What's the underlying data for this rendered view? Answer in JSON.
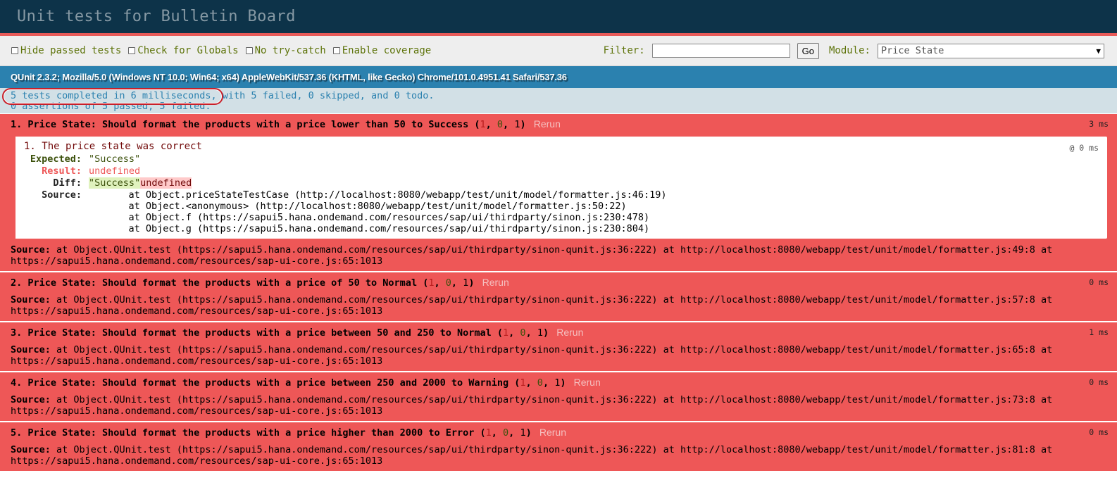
{
  "header": {
    "title": "Unit tests for Bulletin Board"
  },
  "toolbar": {
    "checkboxes": [
      "Hide passed tests",
      "Check for Globals",
      "No try-catch",
      "Enable coverage"
    ],
    "filter_label": "Filter:",
    "filter_value": "",
    "go_label": "Go",
    "module_label": "Module:",
    "module_selected": "Price State"
  },
  "useragent": "QUnit 2.3.2; Mozilla/5.0 (Windows NT 10.0; Win64; x64) AppleWebKit/537.36 (KHTML, like Gecko) Chrome/101.0.4951.41 Safari/537.36",
  "summary": {
    "line1_a": "5 tests completed in 6 milliseconds",
    "line1_b": ", with 5 failed, 0 skipped, and 0 todo.",
    "line2": "0 assertions of 5 passed, 5 failed."
  },
  "colors": {
    "header_bg": "#0d3349",
    "fail_bg": "#ee5757",
    "useragent_bg": "#2b81af",
    "summary_bg": "#d2e0e6",
    "highlight_oval": "#c8202a"
  },
  "tests": [
    {
      "name": "1. Price State: Should format the products with a price lower than 50 to Success",
      "failed": "1",
      "passed": "0",
      "total": "1",
      "rerun": "Rerun",
      "runtime": "3 ms",
      "source_label": "Source:",
      "source": " at Object.QUnit.test (https://sapui5.hana.ondemand.com/resources/sap/ui/thirdparty/sinon-qunit.js:36:222) at http://localhost:8080/webapp/test/unit/model/formatter.js:49:8 at https://sapui5.hana.ondemand.com/resources/sap-ui-core.js:65:1013",
      "assertion": {
        "title": "1. The price state was correct",
        "time": "@ 0 ms",
        "expected_label": "Expected:",
        "expected": "\"Success\"",
        "result_label": "Result:",
        "result": "undefined",
        "diff_label": "Diff:",
        "diff_ins": "\"Success\"",
        "diff_del": "undefined",
        "source_label": "Source:",
        "stack": "    at Object.priceStateTestCase (http://localhost:8080/webapp/test/unit/model/formatter.js:46:19)\n    at Object.<anonymous> (http://localhost:8080/webapp/test/unit/model/formatter.js:50:22)\n    at Object.f (https://sapui5.hana.ondemand.com/resources/sap/ui/thirdparty/sinon.js:230:478)\n    at Object.g (https://sapui5.hana.ondemand.com/resources/sap/ui/thirdparty/sinon.js:230:804)"
      }
    },
    {
      "name": "2. Price State: Should format the products with a price of 50 to Normal",
      "failed": "1",
      "passed": "0",
      "total": "1",
      "rerun": "Rerun",
      "runtime": "0 ms",
      "source_label": "Source:",
      "source": " at Object.QUnit.test (https://sapui5.hana.ondemand.com/resources/sap/ui/thirdparty/sinon-qunit.js:36:222) at http://localhost:8080/webapp/test/unit/model/formatter.js:57:8 at https://sapui5.hana.ondemand.com/resources/sap-ui-core.js:65:1013"
    },
    {
      "name": "3. Price State: Should format the products with a price between 50 and 250 to Normal",
      "failed": "1",
      "passed": "0",
      "total": "1",
      "rerun": "Rerun",
      "runtime": "1 ms",
      "source_label": "Source:",
      "source": " at Object.QUnit.test (https://sapui5.hana.ondemand.com/resources/sap/ui/thirdparty/sinon-qunit.js:36:222) at http://localhost:8080/webapp/test/unit/model/formatter.js:65:8 at https://sapui5.hana.ondemand.com/resources/sap-ui-core.js:65:1013"
    },
    {
      "name": "4. Price State: Should format the products with a price between 250 and 2000 to Warning",
      "failed": "1",
      "passed": "0",
      "total": "1",
      "rerun": "Rerun",
      "runtime": "0 ms",
      "source_label": "Source:",
      "source": " at Object.QUnit.test (https://sapui5.hana.ondemand.com/resources/sap/ui/thirdparty/sinon-qunit.js:36:222) at http://localhost:8080/webapp/test/unit/model/formatter.js:73:8 at https://sapui5.hana.ondemand.com/resources/sap-ui-core.js:65:1013"
    },
    {
      "name": "5. Price State: Should format the products with a price higher than 2000 to Error",
      "failed": "1",
      "passed": "0",
      "total": "1",
      "rerun": "Rerun",
      "runtime": "0 ms",
      "source_label": "Source:",
      "source": " at Object.QUnit.test (https://sapui5.hana.ondemand.com/resources/sap/ui/thirdparty/sinon-qunit.js:36:222) at http://localhost:8080/webapp/test/unit/model/formatter.js:81:8 at https://sapui5.hana.ondemand.com/resources/sap-ui-core.js:65:1013"
    }
  ]
}
